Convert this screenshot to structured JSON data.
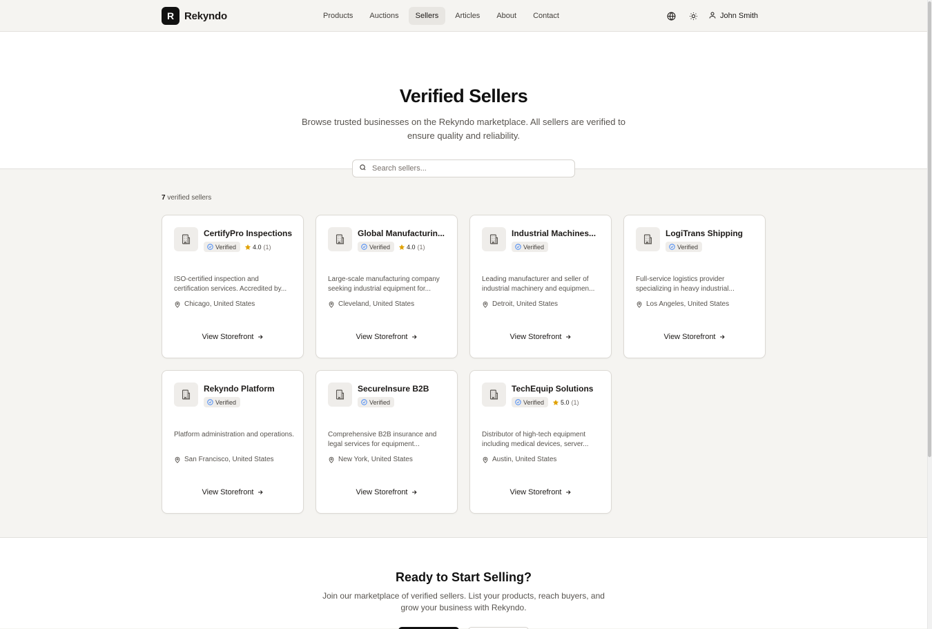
{
  "brand": {
    "logo_letter": "R",
    "name": "Rekyndo"
  },
  "nav": [
    {
      "label": "Products",
      "active": false
    },
    {
      "label": "Auctions",
      "active": false
    },
    {
      "label": "Sellers",
      "active": true
    },
    {
      "label": "Articles",
      "active": false
    },
    {
      "label": "About",
      "active": false
    },
    {
      "label": "Contact",
      "active": false
    }
  ],
  "header": {
    "language_icon": "globe-icon",
    "theme_icon": "sun-icon",
    "user_icon": "user-icon",
    "user_name": "John Smith"
  },
  "hero": {
    "title": "Verified Sellers",
    "subtitle": "Browse trusted businesses on the Rekyndo marketplace. All sellers are verified to ensure quality and reliability.",
    "search_placeholder": "Search sellers..."
  },
  "listing": {
    "count": "7",
    "count_label": "verified sellers"
  },
  "sellers": [
    {
      "name": "CertifyPro Inspections",
      "verified_label": "Verified",
      "rating": "4.0",
      "rating_count": "(1)",
      "description": "ISO-certified inspection and certification services. Accredited by...",
      "location": "Chicago, United States",
      "link_label": "View Storefront"
    },
    {
      "name": "Global Manufacturin...",
      "verified_label": "Verified",
      "rating": "4.0",
      "rating_count": "(1)",
      "description": "Large-scale manufacturing company seeking industrial equipment for...",
      "location": "Cleveland, United States",
      "link_label": "View Storefront"
    },
    {
      "name": "Industrial Machines...",
      "verified_label": "Verified",
      "rating": "",
      "rating_count": "",
      "description": "Leading manufacturer and seller of industrial machinery and equipmen...",
      "location": "Detroit, United States",
      "link_label": "View Storefront"
    },
    {
      "name": "LogiTrans Shipping",
      "verified_label": "Verified",
      "rating": "",
      "rating_count": "",
      "description": "Full-service logistics provider specializing in heavy industrial...",
      "location": "Los Angeles, United States",
      "link_label": "View Storefront"
    },
    {
      "name": "Rekyndo Platform",
      "verified_label": "Verified",
      "rating": "",
      "rating_count": "",
      "description": "Platform administration and operations.",
      "location": "San Francisco, United States",
      "link_label": "View Storefront"
    },
    {
      "name": "SecureInsure B2B",
      "verified_label": "Verified",
      "rating": "",
      "rating_count": "",
      "description": "Comprehensive B2B insurance and legal services for equipment...",
      "location": "New York, United States",
      "link_label": "View Storefront"
    },
    {
      "name": "TechEquip Solutions",
      "verified_label": "Verified",
      "rating": "5.0",
      "rating_count": "(1)",
      "description": "Distributor of high-tech equipment including medical devices, server...",
      "location": "Austin, United States",
      "link_label": "View Storefront"
    }
  ],
  "cta": {
    "title": "Ready to Start Selling?",
    "subtitle": "Join our marketplace of verified sellers. List your products, reach buyers, and grow your business with Rekyndo."
  },
  "colors": {
    "accent": "#111111",
    "star": "#e0a100",
    "verified": "#3b82f6",
    "page_bg": "#f5f4f1"
  }
}
